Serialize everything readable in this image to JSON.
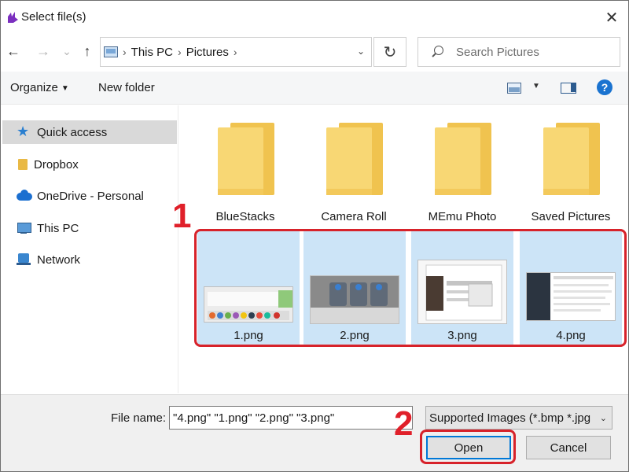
{
  "window": {
    "title": "Select file(s)",
    "close_glyph": "✕"
  },
  "nav": {
    "back_glyph": "←",
    "forward_glyph": "→",
    "recent_glyph": "⌄",
    "up_glyph": "↑",
    "breadcrumbs": [
      "This PC",
      "Pictures"
    ],
    "separator": "›",
    "dropdown_glyph": "⌄",
    "refresh_glyph": "↻",
    "search_placeholder": "Search Pictures"
  },
  "toolbar": {
    "organize_label": "Organize",
    "organize_caret": "▼",
    "new_folder_label": "New folder",
    "view_caret": "▼",
    "help_glyph": "?"
  },
  "sidebar": {
    "items": [
      {
        "label": "Quick access",
        "icon": "star-icon",
        "selected": true
      },
      {
        "label": "Dropbox",
        "icon": "folder-icon"
      },
      {
        "label": "OneDrive - Personal",
        "icon": "cloud-icon"
      },
      {
        "label": "This PC",
        "icon": "pc-icon"
      },
      {
        "label": "Network",
        "icon": "network-icon"
      }
    ]
  },
  "folders": [
    {
      "name": "BlueStacks"
    },
    {
      "name": "Camera Roll"
    },
    {
      "name": "MEmu Photo"
    },
    {
      "name": "Saved Pictures"
    }
  ],
  "files": [
    {
      "name": "1.png",
      "selected": true
    },
    {
      "name": "2.png",
      "selected": true
    },
    {
      "name": "3.png",
      "selected": true
    },
    {
      "name": "4.png",
      "selected": true
    }
  ],
  "annotations": {
    "step1": "1",
    "step2": "2",
    "accent": "#d7222a"
  },
  "bottom": {
    "file_name_label": "File name:",
    "file_name_value": "\"4.png\" \"1.png\" \"2.png\" \"3.png\"",
    "filter_value": "Supported Images (*.bmp *.jpg",
    "filter_caret": "⌄",
    "open_label": "Open",
    "cancel_label": "Cancel"
  }
}
